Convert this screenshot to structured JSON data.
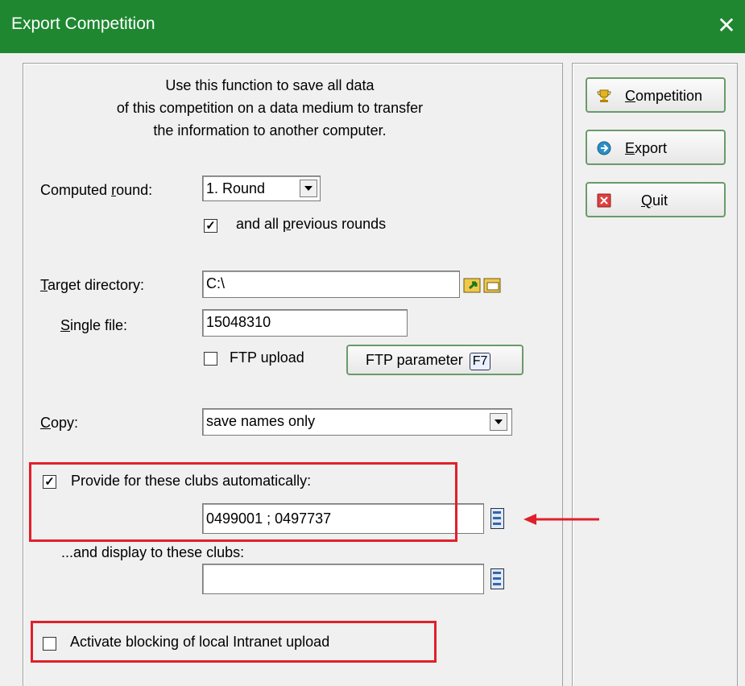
{
  "window": {
    "title": "Export Competition",
    "close_glyph": "✕"
  },
  "intro_lines": [
    "Use this function to save all data",
    "of this competition on a data medium to transfer",
    "the information to another computer."
  ],
  "computed_round": {
    "label_pre": "Computed ",
    "label_accel": "r",
    "label_post": "ound:",
    "value": "1. Round",
    "prev_rounds": {
      "checked": true,
      "label_pre": "and all ",
      "label_accel": "p",
      "label_post": "revious rounds"
    }
  },
  "target": {
    "label_accel": "T",
    "label_post": "arget directory:",
    "value": "C:\\",
    "single_file": {
      "label_accel": "S",
      "label_post": "ingle file:",
      "value": "15048310"
    },
    "ftp_upload": {
      "checked": false,
      "label": "FTP upload"
    },
    "ftp_param_button": {
      "label": "FTP parameter",
      "shortcut": "F7"
    }
  },
  "copy": {
    "label_accel": "C",
    "label_post": "opy:",
    "value": "save names only"
  },
  "provide": {
    "checked": true,
    "label": "Provide for these clubs automatically:",
    "clubs_value": "0499001 ; 0497737"
  },
  "display": {
    "label": "...and display to these clubs:",
    "value": ""
  },
  "intranet": {
    "checked": false,
    "label": "Activate blocking of local Intranet upload"
  },
  "side_buttons": {
    "competition": {
      "accel": "C",
      "rest": "ompetition",
      "icon": "trophy-icon"
    },
    "export": {
      "accel": "E",
      "rest": "xport",
      "icon": "export-arrow-icon"
    },
    "quit": {
      "accel": "Q",
      "rest": "uit",
      "icon": "quit-x-icon"
    }
  },
  "colors": {
    "titlebar": "#1e8730",
    "highlight": "#e0202a",
    "button_border": "#6a9a6a"
  }
}
